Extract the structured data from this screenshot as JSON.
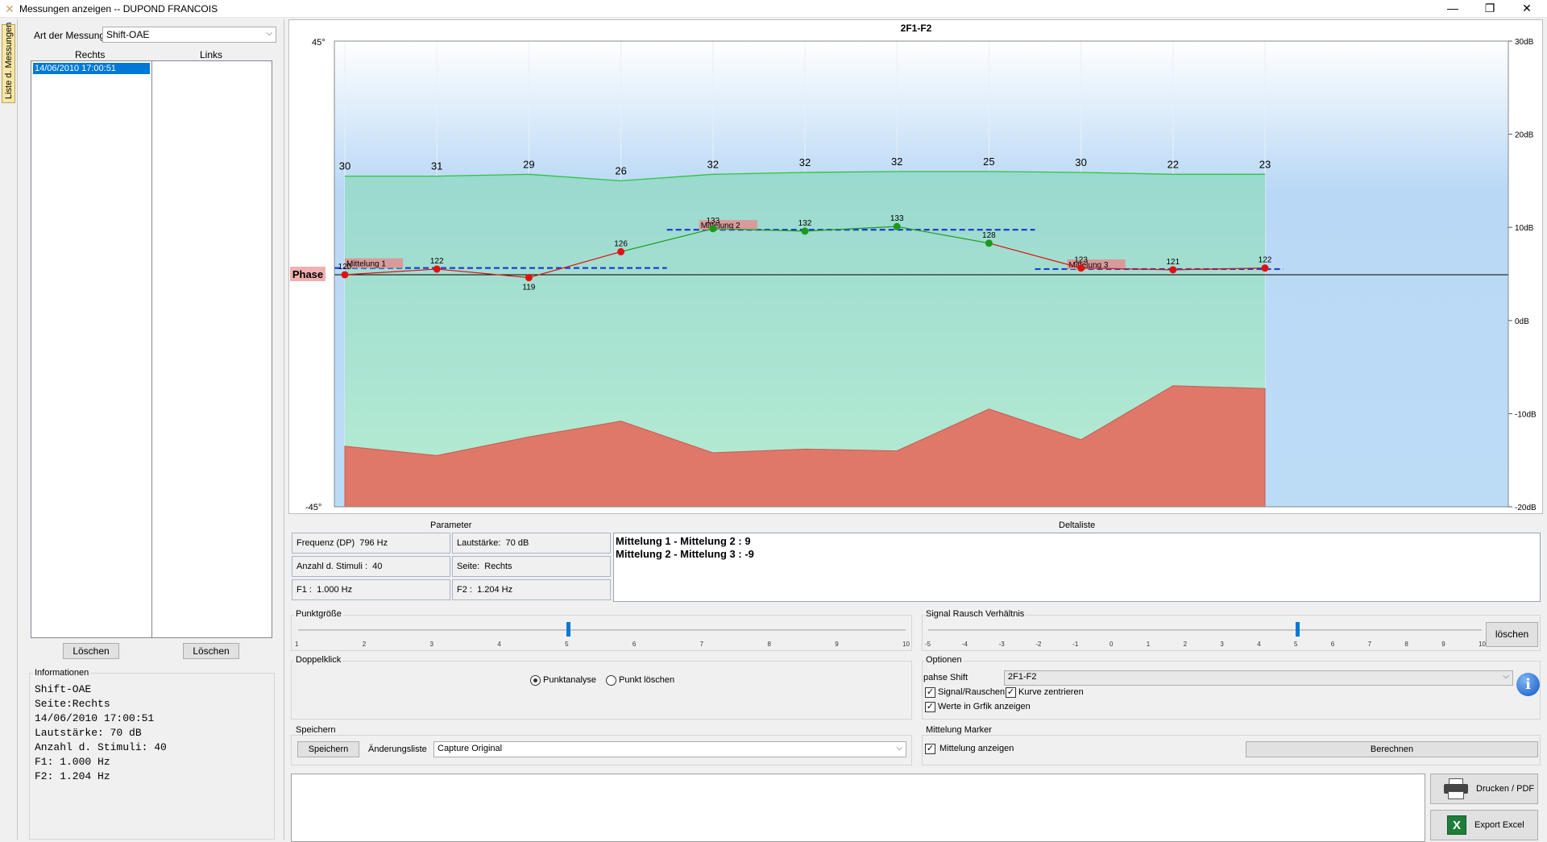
{
  "window": {
    "title": "Messungen anzeigen -- DUPOND FRANCOIS"
  },
  "sidetab": {
    "label": "Liste d. Messungen"
  },
  "left": {
    "type_label": "Art der Messung",
    "type_value": "Shift-OAE",
    "right_header": "Rechts",
    "left_header": "Links",
    "right_items": [
      "14/06/2010 17:00:51"
    ],
    "delete_right": "Löschen",
    "delete_left": "Löschen",
    "info_title": "Informationen",
    "info_lines": [
      "Shift-OAE",
      "Seite:Rechts",
      "14/06/2010 17:00:51",
      "Lautstärke: 70 dB",
      "Anzahl d. Stimuli: 40",
      "F1: 1.000 Hz",
      "F2: 1.204 Hz"
    ]
  },
  "chart_data": {
    "type": "line",
    "title": "2F1-F2",
    "y_left_label": "Phase",
    "y_left_ticks": [
      "45°",
      "-45°"
    ],
    "y_right_ticks": [
      "30dB",
      "20dB",
      "10dB",
      "0dB",
      "-10dB",
      "-20dB"
    ],
    "y_right_range": [
      -20,
      30
    ],
    "x_count": 11,
    "signal_top_labels": [
      30,
      31,
      29,
      26,
      32,
      32,
      32,
      25,
      30,
      22,
      23
    ],
    "signal_db": [
      15.5,
      15.5,
      15.7,
      15.0,
      15.7,
      15.9,
      16.0,
      16.0,
      15.9,
      15.7,
      15.7
    ],
    "noise_db": [
      -13.5,
      -14.5,
      -12.5,
      -10.8,
      -14.2,
      -13.8,
      -14.0,
      -9.5,
      -12.8,
      -7.0,
      -7.3
    ],
    "phase_labels": [
      120,
      122,
      119,
      126,
      133,
      132,
      133,
      128,
      123,
      121,
      122
    ],
    "phase_y_norm": [
      0.0,
      1.6,
      -0.8,
      6.5,
      13.0,
      12.3,
      13.6,
      8.9,
      1.9,
      1.4,
      1.9
    ],
    "point_colors": [
      "#e01010",
      "#e01010",
      "#e01010",
      "#e01010",
      "#1a9a1a",
      "#1a9a1a",
      "#1a9a1a",
      "#1a9a1a",
      "#e01010",
      "#e01010",
      "#e01010"
    ],
    "averages": [
      {
        "label": "Mittelung 1",
        "from": 0,
        "to": 3.5,
        "value": 1.9
      },
      {
        "label": "Mittelung 2",
        "from": 3.5,
        "to": 7.5,
        "value": 12.7
      },
      {
        "label": "Mittelung 3",
        "from": 7.5,
        "to": 10.2,
        "value": 1.6
      }
    ],
    "colors": {
      "signal_fill": "#a8e5cc",
      "signal_line": "#2ec43c",
      "noise_fill": "#e0786a",
      "average_line": "#1f3fd0"
    }
  },
  "parameter": {
    "title": "Parameter",
    "freq_label": "Frequenz (DP)",
    "freq_value": "796 Hz",
    "loud_label": "Lautstärke:",
    "loud_value": "70 dB",
    "stim_label": "Anzahl d. Stimuli :",
    "stim_value": "40",
    "side_label": "Seite:",
    "side_value": "Rechts",
    "f1_label": "F1 :",
    "f1_value": "1.000 Hz",
    "f2_label": "F2 :",
    "f2_value": "1.204 Hz"
  },
  "deltaliste": {
    "title": "Deltaliste",
    "lines": [
      "Mittelung 1 - Mittelung 2 : 9",
      "Mittelung 2 - Mittelung 3 : -9"
    ]
  },
  "punktgroesse": {
    "title": "Punktgröße",
    "ticks": [
      "1",
      "2",
      "3",
      "4",
      "5",
      "6",
      "7",
      "8",
      "9",
      "10"
    ],
    "value": 5
  },
  "snr": {
    "title": "Signal Rausch Verhältnis",
    "ticks": [
      "-5",
      "-4",
      "-3",
      "-2",
      "-1",
      "0",
      "1",
      "2",
      "3",
      "4",
      "5",
      "6",
      "7",
      "8",
      "9",
      "10"
    ],
    "value": 5,
    "delete_label": "löschen"
  },
  "doppelklick": {
    "title": "Doppelklick",
    "opt1": "Punktanalyse",
    "opt2": "Punkt löschen"
  },
  "optionen": {
    "title": "Optionen",
    "shift_label": "pahse Shift",
    "shift_value": "2F1-F2",
    "cb1": "Signal/Rauschen",
    "cb2": "Kurve zentrieren",
    "cb3": "Werte in Grfik anzeigen"
  },
  "speichern": {
    "title": "Speichern",
    "save_btn": "Speichern",
    "list_label": "Änderungsliste",
    "list_value": "Capture Original"
  },
  "marker": {
    "title": "Mittelung Marker",
    "cb": "Mittelung anzeigen",
    "calc_btn": "Berechnen"
  },
  "actions": {
    "print": "Drucken / PDF",
    "excel": "Export Excel"
  }
}
